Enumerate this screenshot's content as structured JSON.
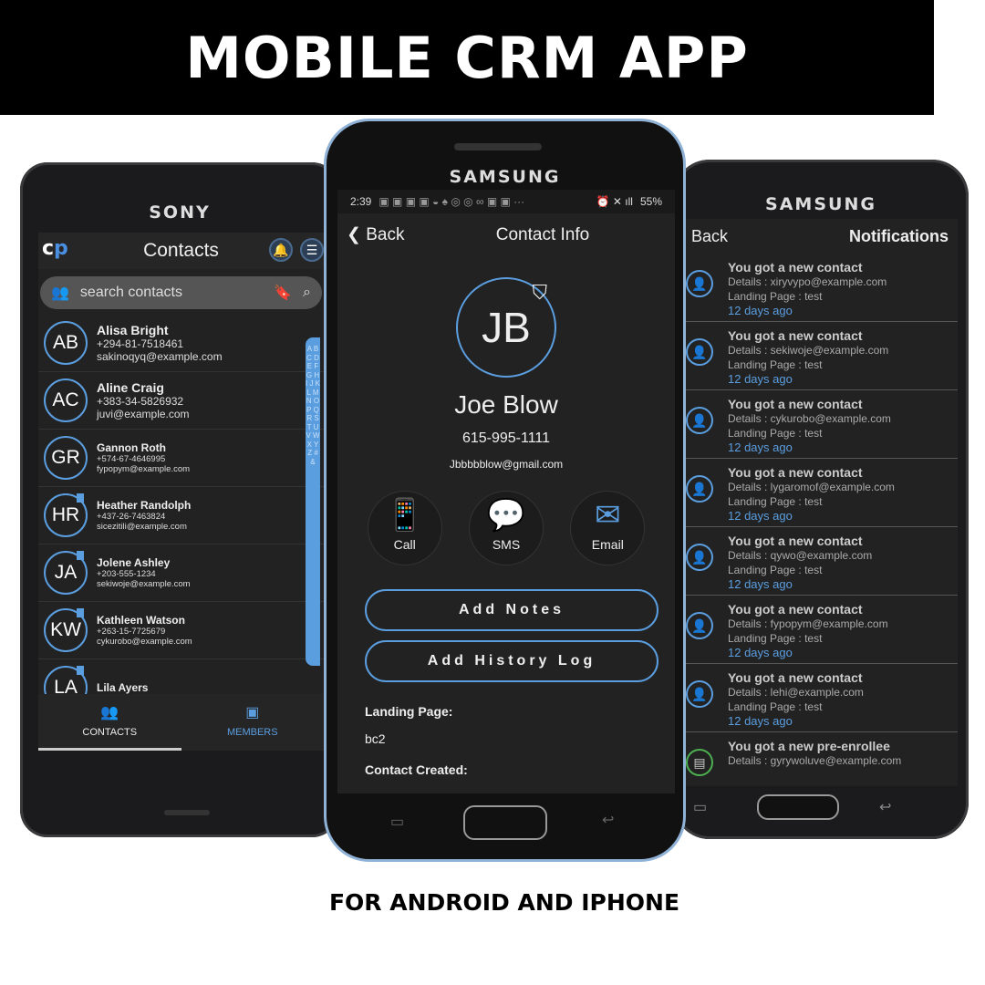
{
  "banner": {
    "title": "MOBILE CRM APP",
    "subtitle": "FOR ANDROID AND IPHONE"
  },
  "left_phone": {
    "brand": "SONY",
    "title": "Contacts",
    "logo": "cp",
    "search_placeholder": "search contacts",
    "contacts": [
      {
        "initials": "AB",
        "name": "Alisa Bright",
        "phone": "+294-81-7518461",
        "email": "sakinoqyq@example.com"
      },
      {
        "initials": "AC",
        "name": "Aline Craig",
        "phone": "+383-34-5826932",
        "email": "juvi@example.com"
      },
      {
        "initials": "GR",
        "name": "Gannon Roth",
        "phone": "+574-67-4646995",
        "email": "fypopym@example.com"
      },
      {
        "initials": "HR",
        "name": "Heather Randolph",
        "phone": "+437-26-7463824",
        "email": "sicezitili@example.com"
      },
      {
        "initials": "JA",
        "name": "Jolene Ashley",
        "phone": "+203-555-1234",
        "email": "sekiwoje@example.com"
      },
      {
        "initials": "KW",
        "name": "Kathleen Watson",
        "phone": "+263-15-7725679",
        "email": "cykurobo@example.com"
      },
      {
        "initials": "LA",
        "name": "Lila Ayers",
        "phone": "",
        "email": ""
      }
    ],
    "alphabet": "A B C D E F G H I J K L M N O P Q R S T U V W X Y Z # &",
    "nav": {
      "contacts": "CONTACTS",
      "members": "MEMBERS"
    }
  },
  "center_phone": {
    "brand": "SAMSUNG",
    "time": "2:39",
    "battery": "55%",
    "back": "Back",
    "title": "Contact Info",
    "initials": "JB",
    "name": "Joe Blow",
    "phone": "615-995-1111",
    "email": "Jbbbbblow@gmail.com",
    "actions": {
      "call": "Call",
      "sms": "SMS",
      "email": "Email"
    },
    "add_notes": "Add Notes",
    "add_history": "Add History Log",
    "landing_label": "Landing Page:",
    "landing_value": "bc2",
    "created_label": "Contact Created:"
  },
  "right_phone": {
    "brand": "SAMSUNG",
    "back": "Back",
    "title": "Notifications",
    "notifications": [
      {
        "title": "You got a new contact",
        "details": "Details : xiryvypo@example.com",
        "landing": "Landing Page : test",
        "age": "12 days ago"
      },
      {
        "title": "You got a new contact",
        "details": "Details : sekiwoje@example.com",
        "landing": "Landing Page : test",
        "age": "12 days ago"
      },
      {
        "title": "You got a new contact",
        "details": "Details : cykurobo@example.com",
        "landing": "Landing Page : test",
        "age": "12 days ago"
      },
      {
        "title": "You got a new contact",
        "details": "Details : lygaromof@example.com",
        "landing": "Landing Page : test",
        "age": "12 days ago"
      },
      {
        "title": "You got a new contact",
        "details": "Details : qywo@example.com",
        "landing": "Landing Page : test",
        "age": "12 days ago"
      },
      {
        "title": "You got a new contact",
        "details": "Details : fypopym@example.com",
        "landing": "Landing Page : test",
        "age": "12 days ago"
      },
      {
        "title": "You got a new contact",
        "details": "Details : lehi@example.com",
        "landing": "Landing Page : test",
        "age": "12 days ago"
      },
      {
        "title": "You got a new pre-enrollee",
        "details": "Details : gyrywoluve@example.com",
        "landing": "",
        "age": ""
      }
    ]
  },
  "colors": {
    "accent": "#5b9ee0",
    "screen_bg": "#222222"
  }
}
